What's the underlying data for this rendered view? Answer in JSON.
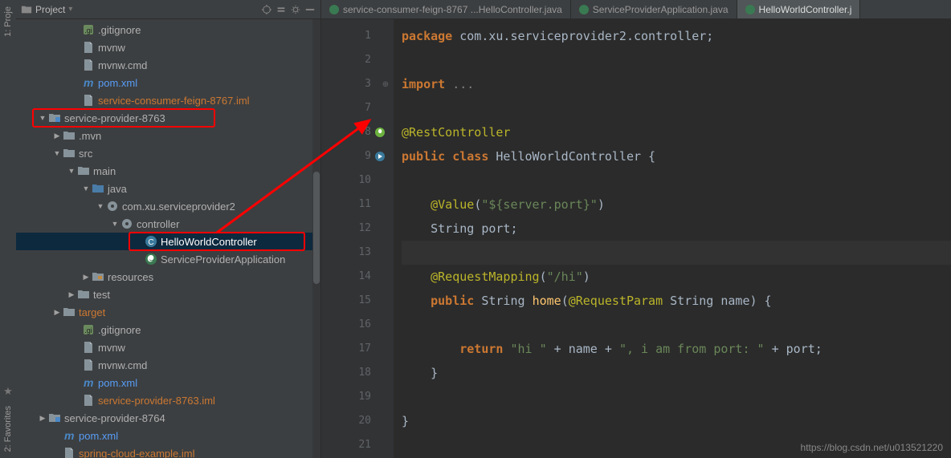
{
  "rail": {
    "project": "1: Proje",
    "favorites": "2: Favorites"
  },
  "sidebar": {
    "title": "Project",
    "items": [
      {
        "indent": 70,
        "arrow": "",
        "icon": "git",
        "label": ".gitignore"
      },
      {
        "indent": 70,
        "arrow": "",
        "icon": "file",
        "label": "mvnw"
      },
      {
        "indent": 70,
        "arrow": "",
        "icon": "file",
        "label": "mvnw.cmd"
      },
      {
        "indent": 70,
        "arrow": "",
        "icon": "m",
        "label": "pom.xml",
        "cls": "blue"
      },
      {
        "indent": 70,
        "arrow": "",
        "icon": "file",
        "label": "service-consumer-feign-8767.iml",
        "cls": "orange"
      },
      {
        "indent": 28,
        "arrow": "▼",
        "icon": "module",
        "label": "service-provider-8763",
        "boxed": true
      },
      {
        "indent": 46,
        "arrow": "▶",
        "icon": "folder",
        "label": ".mvn"
      },
      {
        "indent": 46,
        "arrow": "▼",
        "icon": "folder",
        "label": "src"
      },
      {
        "indent": 64,
        "arrow": "▼",
        "icon": "folder",
        "label": "main"
      },
      {
        "indent": 82,
        "arrow": "▼",
        "icon": "srcfolder",
        "label": "java"
      },
      {
        "indent": 100,
        "arrow": "▼",
        "icon": "pkg",
        "label": "com.xu.serviceprovider2"
      },
      {
        "indent": 118,
        "arrow": "▼",
        "icon": "pkg",
        "label": "controller"
      },
      {
        "indent": 148,
        "arrow": "",
        "icon": "class",
        "label": "HelloWorldController",
        "sel": true,
        "boxed": true
      },
      {
        "indent": 148,
        "arrow": "",
        "icon": "spring",
        "label": "ServiceProviderApplication"
      },
      {
        "indent": 82,
        "arrow": "▶",
        "icon": "resfolder",
        "label": "resources"
      },
      {
        "indent": 64,
        "arrow": "▶",
        "icon": "folder",
        "label": "test"
      },
      {
        "indent": 46,
        "arrow": "▶",
        "icon": "folder",
        "label": "target",
        "cls": "orange"
      },
      {
        "indent": 70,
        "arrow": "",
        "icon": "git",
        "label": ".gitignore"
      },
      {
        "indent": 70,
        "arrow": "",
        "icon": "file",
        "label": "mvnw"
      },
      {
        "indent": 70,
        "arrow": "",
        "icon": "file",
        "label": "mvnw.cmd"
      },
      {
        "indent": 70,
        "arrow": "",
        "icon": "m",
        "label": "pom.xml",
        "cls": "blue"
      },
      {
        "indent": 70,
        "arrow": "",
        "icon": "file",
        "label": "service-provider-8763.iml",
        "cls": "orange"
      },
      {
        "indent": 28,
        "arrow": "▶",
        "icon": "module",
        "label": "service-provider-8764"
      },
      {
        "indent": 46,
        "arrow": "",
        "icon": "m",
        "label": "pom.xml",
        "cls": "blue"
      },
      {
        "indent": 46,
        "arrow": "",
        "icon": "file",
        "label": "spring-cloud-example.iml",
        "cls": "orange"
      }
    ]
  },
  "tabs": [
    {
      "label": "service-consumer-feign-8767 ...HelloController.java",
      "active": false
    },
    {
      "label": "ServiceProviderApplication.java",
      "active": false
    },
    {
      "label": "HelloWorldController.j",
      "active": true
    }
  ],
  "code": {
    "lines": [
      {
        "n": 1,
        "html": "<span class='kw'>package</span> com.xu.serviceprovider2.controller;"
      },
      {
        "n": 2,
        "html": ""
      },
      {
        "n": 3,
        "html": "<span class='kw'>import</span> <span class='dim'>...</span>",
        "fold": "⊕"
      },
      {
        "n": 7,
        "html": ""
      },
      {
        "n": 8,
        "html": "<span class='ann'>@RestController</span>",
        "mark": "leaf"
      },
      {
        "n": 9,
        "html": "<span class='kw'>public</span> <span class='kw'>class</span> HelloWorldController {",
        "mark": "spring"
      },
      {
        "n": 10,
        "html": ""
      },
      {
        "n": 11,
        "html": "    <span class='ann'>@Value</span>(<span class='str'>\"${server.port}\"</span>)"
      },
      {
        "n": 12,
        "html": "    String port;"
      },
      {
        "n": 13,
        "html": "",
        "hl": true
      },
      {
        "n": 14,
        "html": "    <span class='ann'>@RequestMapping</span>(<span class='str'>\"/hi\"</span>)"
      },
      {
        "n": 15,
        "html": "    <span class='kw'>public</span> String <span class='fn'>home</span>(<span class='ann'>@RequestParam</span> String name) {"
      },
      {
        "n": 16,
        "html": ""
      },
      {
        "n": 17,
        "html": "        <span class='kw'>return</span> <span class='str'>\"hi \"</span> + name + <span class='str'>\", i am from port: \"</span> + port;"
      },
      {
        "n": 18,
        "html": "    }"
      },
      {
        "n": 19,
        "html": ""
      },
      {
        "n": 20,
        "html": "}"
      },
      {
        "n": 21,
        "html": ""
      }
    ]
  },
  "watermark": "https://blog.csdn.net/u013521220"
}
